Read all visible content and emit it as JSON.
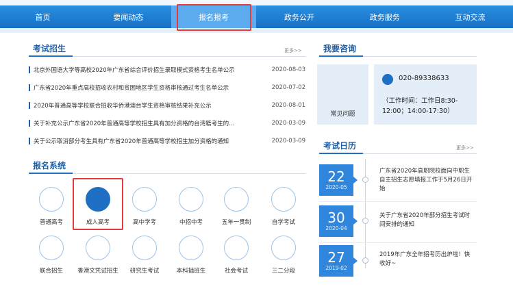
{
  "nav": {
    "items": [
      {
        "label": "首页",
        "active": false
      },
      {
        "label": "要闻动态",
        "active": false
      },
      {
        "label": "报名报考",
        "active": true
      },
      {
        "label": "政务公开",
        "active": false
      },
      {
        "label": "政务服务",
        "active": false
      },
      {
        "label": "互动交流",
        "active": false
      }
    ]
  },
  "exam_recruit": {
    "title": "考试招生",
    "more": "更多>>",
    "news": [
      {
        "text": "北京外国语大学等高校2020年广东省综合评价招生录取模式资格考生名单公示",
        "date": "2020-08-03"
      },
      {
        "text": "广东省2020年重点高校招收农村和贫困地区学生资格审核通过考生名单公示",
        "date": "2020-07-02"
      },
      {
        "text": "2020年普通高等学校联合招收华侨港澳台学生资格审核结果补充公示",
        "date": "2020-08-01"
      },
      {
        "text": "关于补充公示广东省2020年普通高等学校招生具有加分资格的台湾籍考生的...",
        "date": "2020-03-09"
      },
      {
        "text": "关于公示取消部分考生具有广东省2020年普通高等学校招生加分资格的通知",
        "date": "2020-03-09"
      }
    ]
  },
  "registration": {
    "title": "报名系统",
    "items": [
      {
        "label": "普通高考",
        "filled": false
      },
      {
        "label": "成人高考",
        "filled": true
      },
      {
        "label": "高中学考",
        "filled": false
      },
      {
        "label": "中招中考",
        "filled": false
      },
      {
        "label": "五年一贯制",
        "filled": false
      },
      {
        "label": "自学考试",
        "filled": false
      },
      {
        "label": "联合招生",
        "filled": false
      },
      {
        "label": "香港文凭试招生",
        "filled": false
      },
      {
        "label": "研究生考试",
        "filled": false
      },
      {
        "label": "本科插班生",
        "filled": false
      },
      {
        "label": "社会考试",
        "filled": false
      },
      {
        "label": "三二分段",
        "filled": false
      }
    ]
  },
  "consult": {
    "title": "我要咨询",
    "faq_label": "常见问题",
    "phone": "020-89338633",
    "hours": "（工作时间：工作日8:30-12:00；14:00-17:30）"
  },
  "calendar": {
    "title": "考试日历",
    "more": "更多>>",
    "events": [
      {
        "day": "22",
        "ym": "2020-05",
        "text": "广东省2020年高职院校面向中职生自主招生志愿填报工作于5月26日开始"
      },
      {
        "day": "30",
        "ym": "2020-04",
        "text": "关于广东省2020年部分招生考试时间安排的通知"
      },
      {
        "day": "27",
        "ym": "2019-02",
        "text": "2019年广东全年招考历出炉啦！快收好~"
      }
    ]
  },
  "colors": {
    "nav_blue": "#1f7ad4",
    "nav_active": "#5dabef",
    "accent": "#1f6fc4",
    "highlight_red": "#e03a3a"
  }
}
